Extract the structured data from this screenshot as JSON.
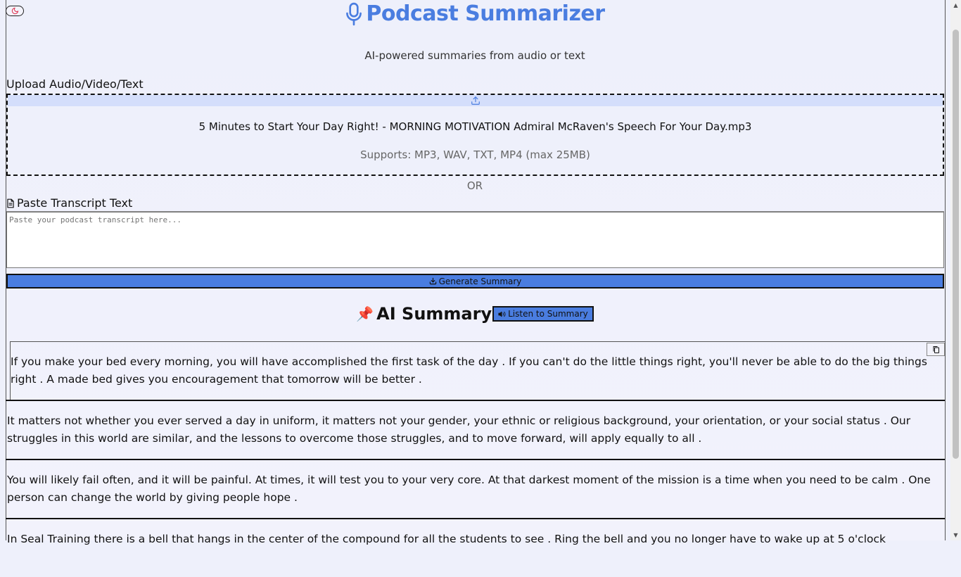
{
  "header": {
    "title": "Podcast Summarizer",
    "subtitle": "AI-powered summaries from audio or text"
  },
  "upload": {
    "label": "Upload Audio/Video/Text",
    "file_name": "5 Minutes to Start Your Day Right! - MORNING MOTIVATION Admiral McRaven's Speech For Your Day.mp3",
    "supports": "Supports: MP3, WAV, TXT, MP4 (max 25MB)"
  },
  "divider_or": "OR",
  "transcript": {
    "label": "Paste Transcript Text",
    "placeholder": "Paste your podcast transcript here..."
  },
  "generate_button": "Generate Summary",
  "summary": {
    "pin": "📌",
    "title": "AI Summary",
    "listen_button": "Listen to Summary",
    "paragraphs": [
      "If you make your bed every morning, you will have accomplished the first task of the day . If you can't do the little things right, you'll never be able to do the big things right . A made bed gives you encouragement that tomorrow will be better .",
      "It matters not whether you ever served a day in uniform, it matters not your gender, your ethnic or religious background, your orientation, or your social status . Our struggles in this world are similar, and the lessons to overcome those struggles, and to move forward, will apply equally to all .",
      "You will likely fail often, and it will be painful. At times, it will test you to your very core. At that darkest moment of the mission is a time when you need to be calm . One person can change the world by giving people hope .",
      "In Seal Training there is a bell that hangs in the center of the compound for all the students to see . Ring the bell and you no longer have to wake up at 5 o'clock"
    ]
  },
  "icons": {
    "theme": "moon-icon",
    "title": "microphone-icon",
    "upload": "upload-icon",
    "paste": "file-text-icon",
    "generate": "download-icon",
    "listen": "volume-icon",
    "copy": "copy-icon"
  },
  "colors": {
    "accent": "#4a7de0",
    "background": "#eef0fb",
    "dropzone_band": "#d4defb"
  }
}
